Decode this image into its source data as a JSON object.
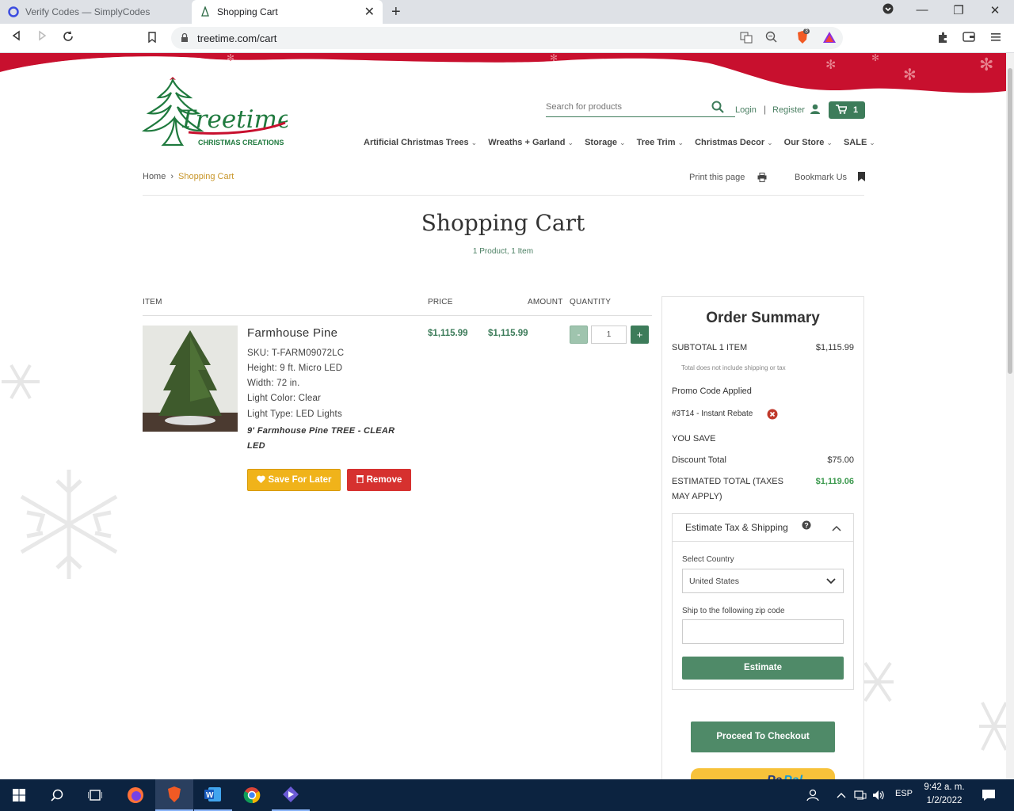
{
  "browser": {
    "tabs": [
      {
        "title": "Verify Codes — SimplyCodes",
        "active": false
      },
      {
        "title": "Shopping Cart",
        "active": true
      }
    ],
    "url": "treetime.com/cart",
    "shield_count": "3"
  },
  "site": {
    "logo_text": "Treetime",
    "logo_sub": "CHRISTMAS CREATIONS",
    "search_placeholder": "Search for products",
    "login": "Login",
    "separator": "|",
    "register": "Register",
    "cart_count": "1",
    "nav": [
      {
        "label": "Artificial Christmas Trees"
      },
      {
        "label": "Wreaths + Garland"
      },
      {
        "label": "Storage"
      },
      {
        "label": "Tree Trim"
      },
      {
        "label": "Christmas Decor"
      },
      {
        "label": "Our Store"
      },
      {
        "label": "SALE"
      }
    ]
  },
  "breadcrumb": {
    "home": "Home",
    "sep": "›",
    "current": "Shopping Cart"
  },
  "utility": {
    "print": "Print this page",
    "bookmark": "Bookmark Us"
  },
  "cart": {
    "title": "Shopping Cart",
    "subtitle": "1 Product, 1 Item",
    "headers": {
      "item": "ITEM",
      "price": "PRICE",
      "amount": "AMOUNT",
      "quantity": "QUANTITY"
    },
    "item": {
      "name": "Farmhouse Pine",
      "specs": [
        "SKU: T-FARM09072LC",
        "Height: 9 ft. Micro LED",
        "Width: 72 in.",
        "Light Color: Clear",
        "Light Type: LED Lights"
      ],
      "description": "9' Farmhouse Pine TREE - CLEAR LED",
      "price": "$1,115.99",
      "amount": "$1,115.99",
      "qty": "1",
      "minus": "-",
      "plus": "+",
      "save_label": "Save For Later",
      "remove_label": "Remove"
    }
  },
  "summary": {
    "title": "Order Summary",
    "subtotal_label": "SUBTOTAL 1 ITEM",
    "subtotal": "$1,115.99",
    "note": "Total does not include shipping or tax",
    "promo_label": "Promo Code Applied",
    "promo_code": "#3T14 - Instant Rebate",
    "you_save": "YOU SAVE",
    "discount_label": "Discount Total",
    "discount": "$75.00",
    "est_label_1": "ESTIMATED TOTAL (TAXES",
    "est_label_2": "MAY APPLY)",
    "est_total": "$1,119.06",
    "tax_title": "Estimate Tax & Shipping",
    "country_label": "Select Country",
    "country_value": "United States",
    "zip_label": "Ship to the following zip code",
    "estimate_btn": "Estimate",
    "checkout_btn": "Proceed To Checkout"
  },
  "taskbar": {
    "lang": "ESP",
    "time": "9:42 a. m.",
    "date": "1/2/2022"
  },
  "colors": {
    "brand_green": "#3d7c5a",
    "accent_gold": "#c8962a",
    "remove_red": "#d6312f",
    "save_yellow": "#f0b31a"
  }
}
